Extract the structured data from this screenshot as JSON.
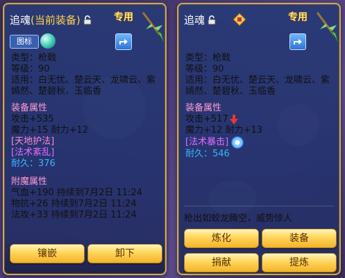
{
  "left": {
    "title": "追魂",
    "title_suffix": "(当前装备)",
    "badge": "专用",
    "icon_button": "图标",
    "info_lines": [
      "类型：枪戟",
      "等级：90",
      "适用：白无忧、楚云天、龙啸云、紫嫣然、楚碧秋、玉临香"
    ],
    "attr_header": "装备属性",
    "attack": "攻击+535",
    "magic_stamina": "魔力+15 耐力+12",
    "skill1": "[天地护法]",
    "skill2": "[法术紊乱]",
    "durability": "耐久：376",
    "enchant_header": "附魔属性",
    "enchant_lines": [
      "气血+190 持续到7月2日 11:24",
      "物抗+26 持续到7月2日 11:24",
      "法攻+33 持续到7月2日 11:24"
    ],
    "buttons": [
      "镶嵌",
      "卸下"
    ]
  },
  "right": {
    "title": "追魂",
    "badge": "专用",
    "info_lines": [
      "类型：枪戟",
      "等级：90",
      "适用：白无忧、楚云天、龙啸云、紫嫣然、楚碧秋、玉临香"
    ],
    "attr_header": "装备属性",
    "attack": "攻击+517",
    "magic_stamina": "魔力+12 耐力+13",
    "skill1": "[法术暴击]",
    "durability": "耐久：546",
    "flavor": "枪出如蛟龙腾空，威势惊人",
    "buttons": [
      "炼化",
      "装备",
      "捐献",
      "提炼"
    ]
  },
  "colors": {
    "panel_border": "#c9a866",
    "title_suffix": "#ffd54a",
    "section": "#ff9ad2",
    "skill_purple": "#e26bff",
    "durability_blue": "#38b6ff",
    "button_gold": "#ffd45a",
    "down_arrow": "#e53935"
  }
}
